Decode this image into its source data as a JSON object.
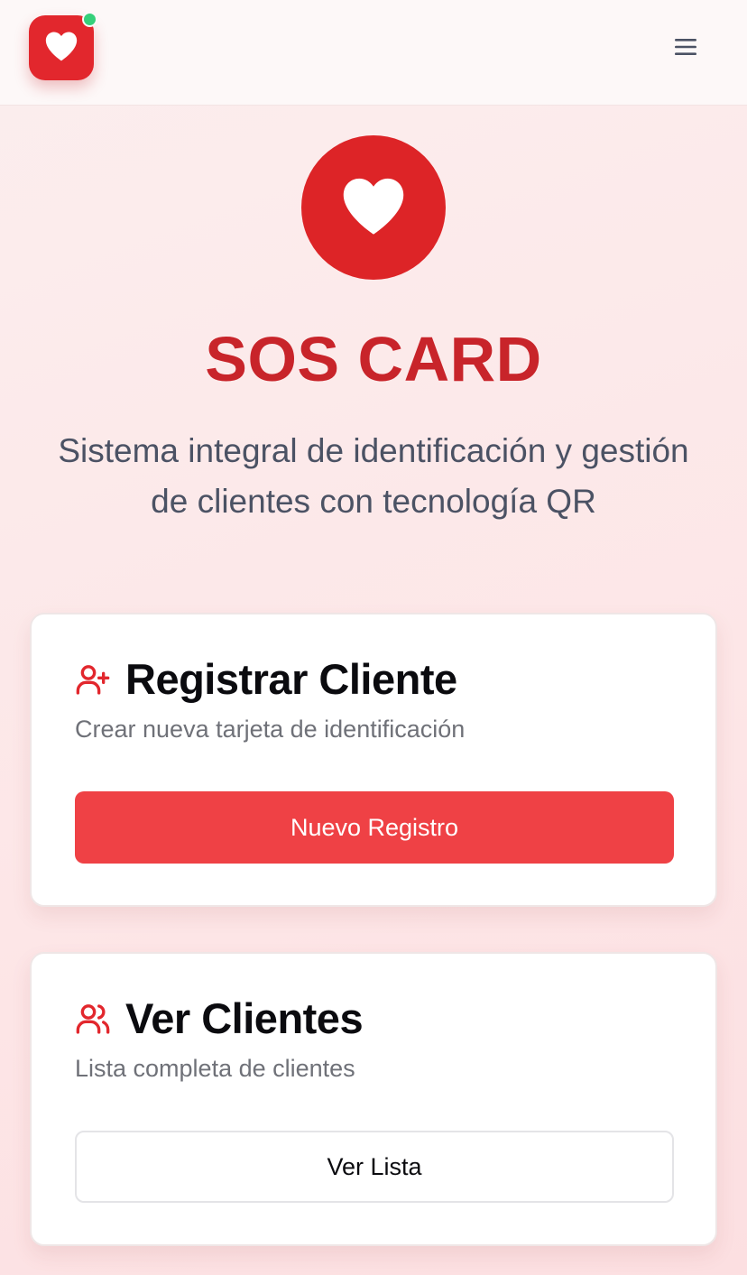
{
  "header": {
    "logo_icon": "heart-icon",
    "status_color": "#35d07a",
    "menu_icon": "hamburger-menu-icon"
  },
  "hero": {
    "icon": "heart-icon",
    "title": "SOS CARD",
    "subtitle": "Sistema integral de identificación y gestión de clientes con tecnología QR"
  },
  "cards": [
    {
      "icon": "user-plus-icon",
      "title": "Registrar Cliente",
      "description": "Crear nueva tarjeta de identificación",
      "button_label": "Nuevo Registro"
    },
    {
      "icon": "users-icon",
      "title": "Ver Clientes",
      "description": "Lista completa de clientes",
      "button_label": "Ver Lista"
    }
  ],
  "colors": {
    "brand_red": "#dd2427",
    "title_red": "#c8242a",
    "primary_button": "#ef4145"
  }
}
